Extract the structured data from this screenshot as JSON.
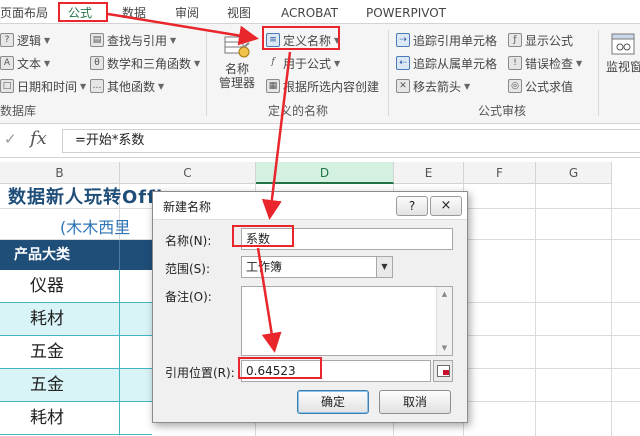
{
  "tabs": [
    {
      "label": "页面布局"
    },
    {
      "label": "公式"
    },
    {
      "label": "数据"
    },
    {
      "label": "审阅"
    },
    {
      "label": "视图"
    },
    {
      "label": "ACROBAT"
    },
    {
      "label": "POWERPIVOT"
    }
  ],
  "ribbon": {
    "library": {
      "items": [
        "逻辑",
        "文本",
        "日期和时间",
        "查找与引用",
        "数学和三角函数",
        "其他函数"
      ],
      "group_label": "数据库"
    },
    "defined_names": {
      "name_manager": "名称\n管理器",
      "define_name": "定义名称",
      "use_in_formula": "用于公式",
      "create_from_selection": "根据所选内容创建",
      "group_label": "定义的名称"
    },
    "auditing": {
      "trace_precedents": "追踪引用单元格",
      "trace_dependents": "追踪从属单元格",
      "remove_arrows": "移去箭头",
      "show_formulas": "显示公式",
      "error_checking": "错误检查",
      "evaluate_formula": "公式求值",
      "group_label": "公式审核"
    },
    "watch_window": "监视窗"
  },
  "formula_bar": {
    "fx": "fx",
    "check": "✓",
    "value": "=开始*系数"
  },
  "columns": [
    {
      "label": "B"
    },
    {
      "label": "C"
    },
    {
      "label": "D"
    },
    {
      "label": "E"
    },
    {
      "label": "F"
    },
    {
      "label": "G"
    }
  ],
  "sheet": {
    "title": "数据新人玩转Office",
    "subtitle": "(木木西里",
    "header": "产品大类",
    "rows": [
      "仪器",
      "耗材",
      "五金",
      "五金",
      "耗材"
    ]
  },
  "dialog": {
    "title": "新建名称",
    "help": "?",
    "close": "×",
    "name_label": "名称(N):",
    "name_value": "系数",
    "scope_label": "范围(S):",
    "scope_value": "工作簿",
    "comment_label": "备注(O):",
    "ref_label": "引用位置(R):",
    "ref_value": "0.64523",
    "ok": "确定",
    "cancel": "取消"
  },
  "colors": {
    "accent": "#217346",
    "header_fill": "#1f4e79",
    "alt_row": "#d9f4f6",
    "annotation": "#e8262c"
  }
}
